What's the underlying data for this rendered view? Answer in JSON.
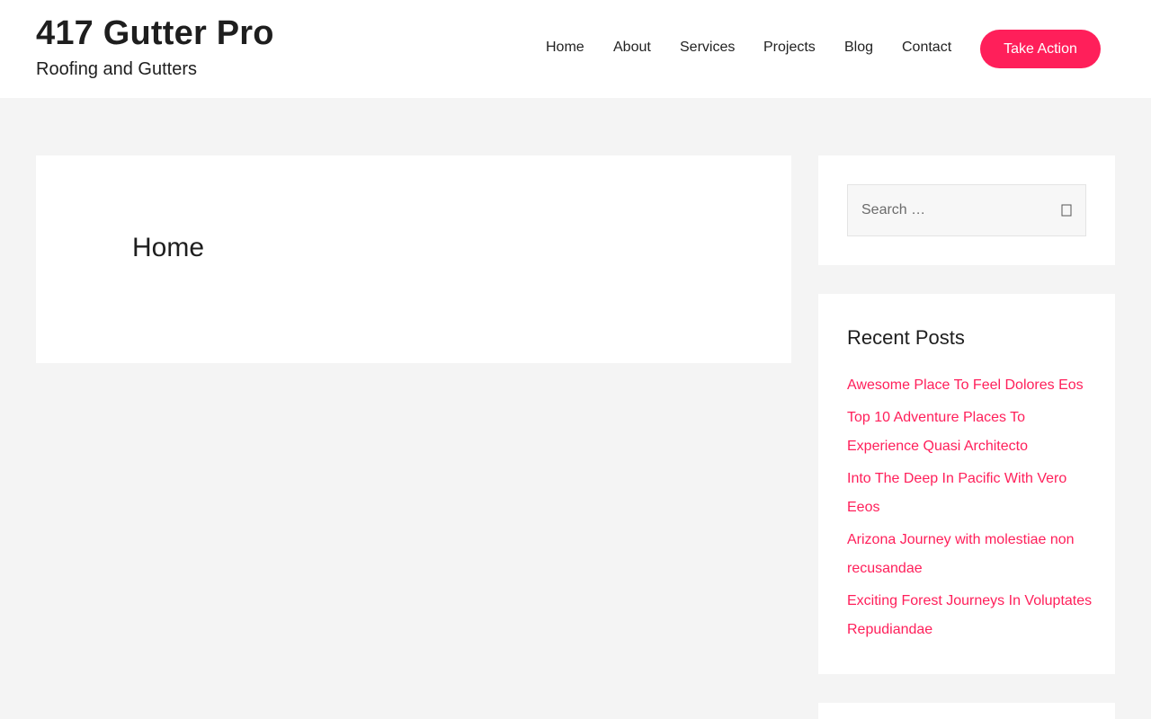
{
  "header": {
    "site_title": "417 Gutter Pro",
    "tagline": "Roofing and Gutters",
    "nav": [
      "Home",
      "About",
      "Services",
      "Projects",
      "Blog",
      "Contact"
    ],
    "cta_label": "Take Action"
  },
  "main": {
    "page_title": "Home"
  },
  "sidebar": {
    "search": {
      "placeholder": "Search …",
      "icon": "search-icon"
    },
    "recent_posts": {
      "title": "Recent Posts",
      "items": [
        "Awesome Place To Feel Dolores Eos",
        "Top 10 Adventure Places To Experience Quasi Architecto",
        "Into The Deep In Pacific With Vero Eeos",
        "Arizona Journey with molestiae non recusandae",
        "Exciting Forest Journeys In Voluptates Repudiandae"
      ]
    }
  },
  "colors": {
    "accent": "#ff1f5a",
    "background": "#f4f4f4",
    "card": "#ffffff"
  }
}
